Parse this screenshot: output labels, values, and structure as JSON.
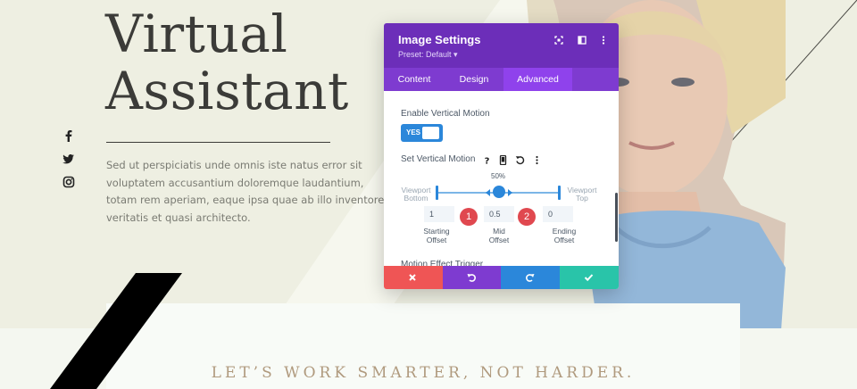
{
  "hero": {
    "title_line1": "Virtual",
    "title_line2": "Assistant",
    "text": "Sed ut perspiciatis unde omnis iste natus error sit voluptatem accusantium doloremque laudantium, totam rem aperiam, eaque ipsa quae ab illo inventore veritatis et quasi architecto."
  },
  "social": [
    "facebook-icon",
    "twitter-icon",
    "instagram-icon"
  ],
  "tagline": "LET’S WORK SMARTER, NOT HARDER.",
  "modal": {
    "title": "Image Settings",
    "preset": "Preset: Default ▾",
    "header_icons": [
      "fullscreen-icon",
      "split-view-icon",
      "more-icon"
    ],
    "tabs": [
      {
        "label": "Content",
        "active": false
      },
      {
        "label": "Design",
        "active": false
      },
      {
        "label": "Advanced",
        "active": true
      }
    ],
    "enable_vertical_motion_label": "Enable Vertical Motion",
    "toggle_label": "YES",
    "set_vertical_motion_label": "Set Vertical Motion",
    "option_icons": [
      "help-icon",
      "mobile-icon",
      "reset-icon",
      "more-icon"
    ],
    "slider": {
      "percent_label": "50%",
      "left_label_1": "Viewport",
      "left_label_2": "Bottom",
      "right_label_1": "Viewport",
      "right_label_2": "Top",
      "mid_position": 0.5
    },
    "fields": [
      {
        "value": "1",
        "label_1": "Starting",
        "label_2": "Offset"
      },
      {
        "value": "0.5",
        "label_1": "Mid",
        "label_2": "Offset"
      },
      {
        "value": "0",
        "label_1": "Ending",
        "label_2": "Offset"
      }
    ],
    "badges": [
      "1",
      "2"
    ],
    "motion_trigger_label": "Motion Effect Trigger",
    "footer_buttons": [
      {
        "name": "cancel",
        "color": "#ef5555"
      },
      {
        "name": "undo",
        "color": "#7e3bd0"
      },
      {
        "name": "redo",
        "color": "#2b87da"
      },
      {
        "name": "save",
        "color": "#29c4a9"
      }
    ]
  },
  "colors": {
    "header_purple": "#6c2eb9",
    "tab_purple": "#7e3bd0",
    "accent_blue": "#2b87da",
    "badge_red": "#e0484f",
    "tagline_tan": "#b09a7e"
  }
}
